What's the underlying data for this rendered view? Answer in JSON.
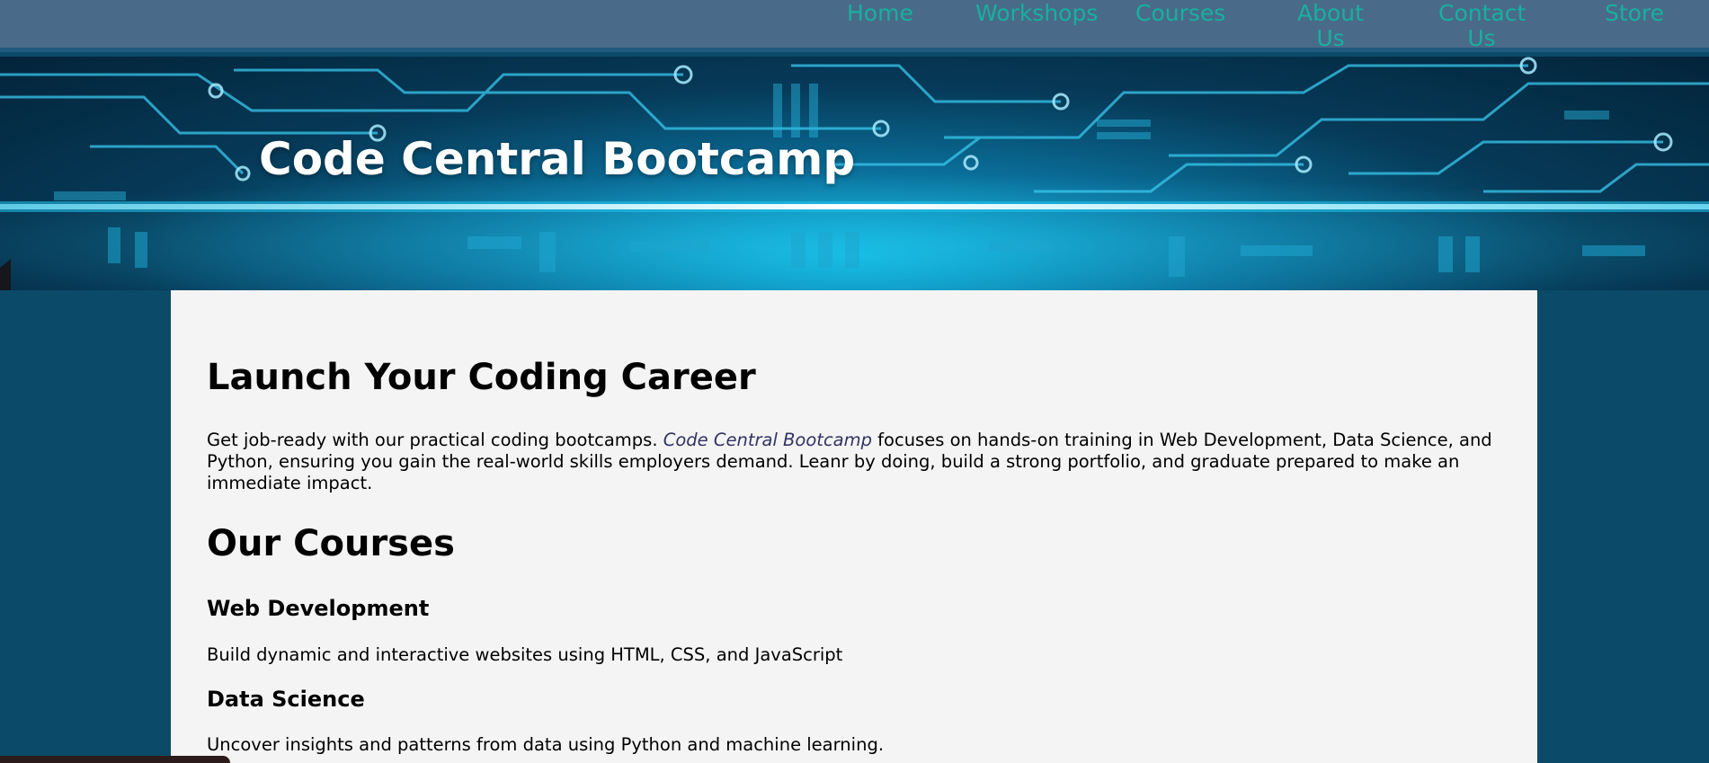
{
  "nav": {
    "items": [
      {
        "label": "Home"
      },
      {
        "label": "Workshops"
      },
      {
        "label": "Courses"
      },
      {
        "label": "About Us"
      },
      {
        "label": "Contact Us"
      },
      {
        "label": "Store"
      }
    ]
  },
  "hero": {
    "title": "Code Central Bootcamp"
  },
  "main": {
    "heading": "Launch Your Coding Career",
    "intro_before": "Get job-ready with our practical coding bootcamps. ",
    "intro_brand": "Code Central Bootcamp",
    "intro_after": " focuses on hands-on training in Web Development, Data Science, and Python, ensuring you gain the real-world skills employers demand. Leanr by doing, build a strong portfolio, and graduate prepared to make an immediate impact.",
    "courses_heading": "Our Courses",
    "courses": [
      {
        "title": "Web Development",
        "description": "Build dynamic and interactive websites using HTML, CSS, and JavaScript"
      },
      {
        "title": "Data Science",
        "description": "Uncover insights and patterns from data using Python and machine learning."
      }
    ]
  },
  "colors": {
    "page_background": "#0b4a68",
    "navbar_background": "#4a6a89",
    "nav_link": "#17b0a0",
    "content_background": "#f4f4f4",
    "brand_link": "#333366"
  }
}
